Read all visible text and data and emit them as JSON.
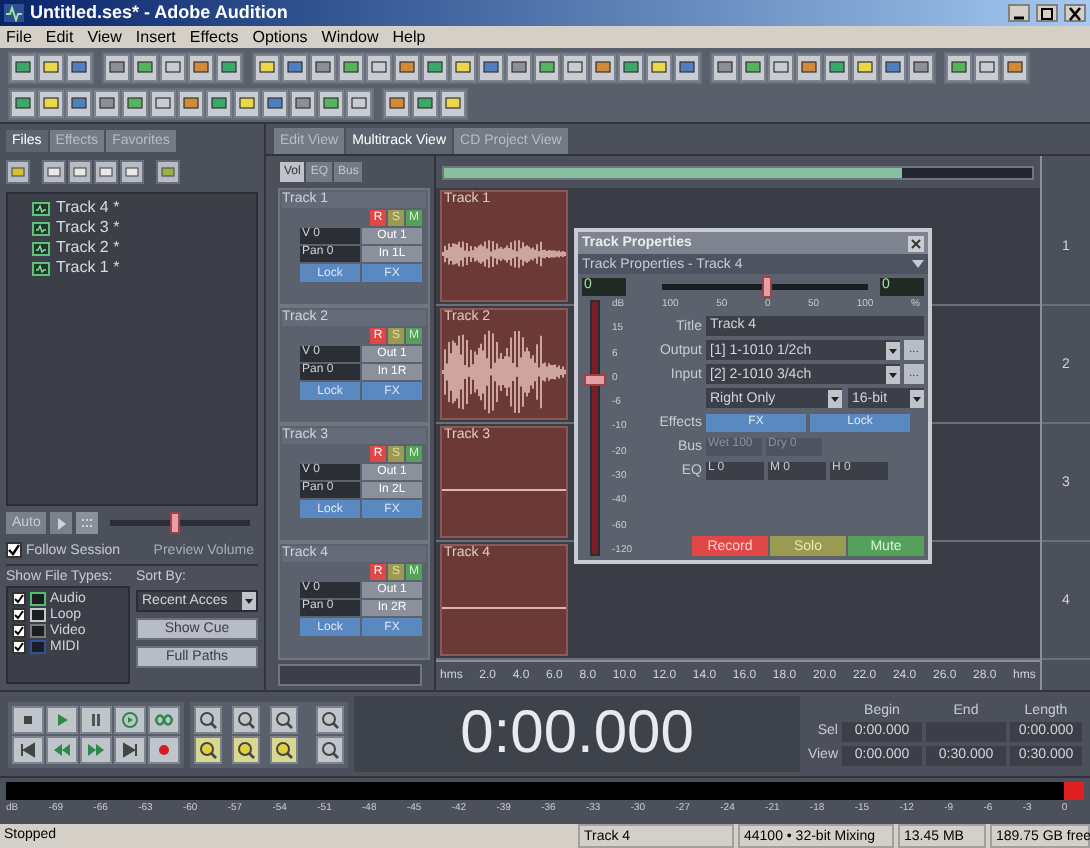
{
  "window": {
    "title": "Untitled.ses* - Adobe Audition"
  },
  "menu": [
    "File",
    "Edit",
    "View",
    "Insert",
    "Effects",
    "Options",
    "Window",
    "Help"
  ],
  "files_panel": {
    "tabs": [
      {
        "label": "Files",
        "selected": true
      },
      {
        "label": "Effects",
        "selected": false
      },
      {
        "label": "Favorites",
        "selected": false
      }
    ],
    "files": [
      {
        "name": "Track 4 *"
      },
      {
        "name": "Track 3 *"
      },
      {
        "name": "Track 2 *"
      },
      {
        "name": "Track 1 *"
      }
    ],
    "auto_button": "Auto",
    "follow_session": {
      "label": "Follow Session",
      "checked": true
    },
    "preview_volume": {
      "label": "Preview Volume",
      "level": 0.45
    },
    "show_file_types": {
      "label": "Show File Types:",
      "types": [
        {
          "label": "Audio",
          "checked": true
        },
        {
          "label": "Loop",
          "checked": true
        },
        {
          "label": "Video",
          "checked": true
        },
        {
          "label": "MIDI",
          "checked": true
        }
      ]
    },
    "sort_by": {
      "label": "Sort By:",
      "value": "Recent Acces"
    },
    "buttons": [
      "Show Cue",
      "Full Paths"
    ]
  },
  "view_tabs": [
    {
      "label": "Edit View",
      "selected": false
    },
    {
      "label": "Multitrack View",
      "selected": true
    },
    {
      "label": "CD Project View",
      "selected": false
    }
  ],
  "mixer_tabs": [
    {
      "label": "Vol",
      "selected": true
    },
    {
      "label": "EQ",
      "selected": false
    },
    {
      "label": "Bus",
      "selected": false
    }
  ],
  "tracks": [
    {
      "name": "Track 1",
      "buttons": [
        "R",
        "S",
        "M"
      ],
      "volume": "V 0",
      "output": "Out 1",
      "pan": "Pan 0",
      "input": "In 1L",
      "lock": "Lock",
      "fx": "FX",
      "clip": {
        "label": "Track 1",
        "kind": "quiet"
      }
    },
    {
      "name": "Track 2",
      "buttons": [
        "R",
        "S",
        "M"
      ],
      "volume": "V 0",
      "output": "Out 1",
      "pan": "Pan 0",
      "input": "In 1R",
      "lock": "Lock",
      "fx": "FX",
      "clip": {
        "label": "Track 2",
        "kind": "loud"
      }
    },
    {
      "name": "Track 3",
      "buttons": [
        "R",
        "S",
        "M"
      ],
      "volume": "V 0",
      "output": "Out 1",
      "pan": "Pan 0",
      "input": "In 2L",
      "lock": "Lock",
      "fx": "FX",
      "clip": {
        "label": "Track 3",
        "kind": "silent"
      }
    },
    {
      "name": "Track 4",
      "buttons": [
        "R",
        "S",
        "M"
      ],
      "volume": "V 0",
      "output": "Out 1",
      "pan": "Pan 0",
      "input": "In 2R",
      "lock": "Lock",
      "fx": "FX",
      "clip": {
        "label": "Track 4",
        "kind": "silent"
      }
    }
  ],
  "overview": {
    "level": 0.78
  },
  "track_numbers": [
    "1",
    "2",
    "3",
    "4"
  ],
  "timeline": [
    "hms",
    "2.0",
    "4.0",
    "6.0",
    "8.0",
    "10.0",
    "12.0",
    "14.0",
    "16.0",
    "18.0",
    "20.0",
    "22.0",
    "24.0",
    "26.0",
    "28.0",
    "hms"
  ],
  "track_properties": {
    "title": "Track Properties",
    "selector": "Track Properties - Track 4",
    "volume_value": "0",
    "pan_value": "0",
    "pan": {
      "level": 0.5
    },
    "pan_scale": [
      "100",
      "50",
      "0",
      "50",
      "100",
      "%"
    ],
    "fader": {
      "level": 0.69
    },
    "fader_scale": [
      "dB",
      "15",
      "6",
      "0",
      "-6",
      "-10",
      "-20",
      "-30",
      "-40",
      "-60",
      "-120"
    ],
    "title_label": "Title",
    "title_value": "Track 4",
    "output_label": "Output",
    "output_value": "[1] 1-1010 1/2ch",
    "input_label": "Input",
    "input_value": "[2] 2-1010 3/4ch",
    "channel": "Right Only",
    "bit_depth": "16-bit",
    "more": "...",
    "effects_label": "Effects",
    "effects_buttons": [
      "FX",
      "Lock"
    ],
    "bus_label": "Bus",
    "bus_values": [
      "Wet 100",
      "Dry 0"
    ],
    "eq_label": "EQ",
    "eq_values": [
      "L 0",
      "M 0",
      "H 0"
    ],
    "buttons": [
      {
        "label": "Record",
        "kind": "record"
      },
      {
        "label": "Solo",
        "kind": "solo"
      },
      {
        "label": "Mute",
        "kind": "mute"
      }
    ]
  },
  "transport": {
    "time": "0:00.000"
  },
  "selection": {
    "headers": [
      "Begin",
      "End",
      "Length"
    ],
    "rows": [
      {
        "label": "Sel",
        "begin": "0:00.000",
        "length": "0:00.000"
      },
      {
        "label": "View",
        "begin": "0:00.000",
        "end": "0:30.000",
        "length": "0:30.000"
      }
    ]
  },
  "meter": {
    "clip": true,
    "scale": [
      "dB",
      "-69",
      "-66",
      "-63",
      "-60",
      "-57",
      "-54",
      "-51",
      "-48",
      "-45",
      "-42",
      "-39",
      "-36",
      "-33",
      "-30",
      "-27",
      "-24",
      "-21",
      "-18",
      "-15",
      "-12",
      "-9",
      "-6",
      "-3",
      "0"
    ]
  },
  "status_bar": [
    "Stopped",
    "Track 4",
    "44100 • 32-bit Mixing",
    "13.45 MB",
    "189.75 GB free"
  ]
}
